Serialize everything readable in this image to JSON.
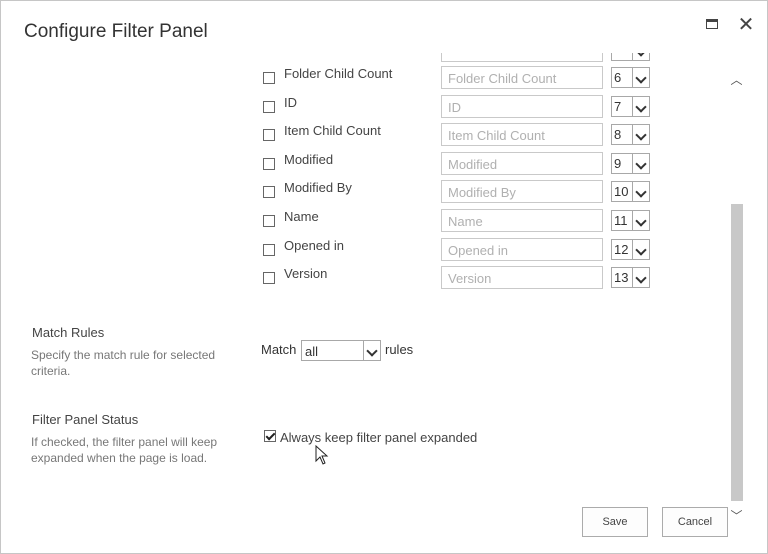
{
  "dialog": {
    "title": "Configure Filter Panel",
    "maximize_icon": "maximize-icon",
    "close_icon": "close-icon",
    "close_glyph": "✕"
  },
  "fields": [
    {
      "label": "Folder Child Count",
      "display_name": "Folder Child Count",
      "order": "6",
      "checked": false
    },
    {
      "label": "ID",
      "display_name": "ID",
      "order": "7",
      "checked": false
    },
    {
      "label": "Item Child Count",
      "display_name": "Item Child Count",
      "order": "8",
      "checked": false
    },
    {
      "label": "Modified",
      "display_name": "Modified",
      "order": "9",
      "checked": false
    },
    {
      "label": "Modified By",
      "display_name": "Modified By",
      "order": "10",
      "checked": false
    },
    {
      "label": "Name",
      "display_name": "Name",
      "order": "11",
      "checked": false
    },
    {
      "label": "Opened in",
      "display_name": "Opened in",
      "order": "12",
      "checked": false
    },
    {
      "label": "Version",
      "display_name": "Version",
      "order": "13",
      "checked": false
    }
  ],
  "match_rules": {
    "title": "Match Rules",
    "description": "Specify the match rule for selected criteria.",
    "prefix": "Match",
    "selected": "all",
    "suffix": "rules"
  },
  "filter_panel_status": {
    "title": "Filter Panel Status",
    "description": "If checked, the filter panel will keep expanded when the page is load.",
    "checkbox_label": "Always keep filter panel expanded",
    "checked": true
  },
  "buttons": {
    "save": "Save",
    "cancel": "Cancel"
  },
  "scrollbar": {
    "up_glyph": "︿",
    "down_glyph": "﹀"
  }
}
